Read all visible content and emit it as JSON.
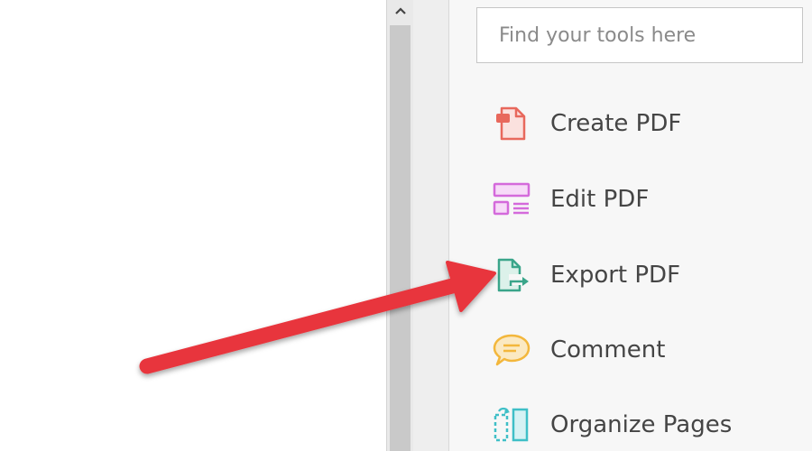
{
  "search": {
    "placeholder": "Find your tools here",
    "value": ""
  },
  "tools": [
    {
      "label": "Create PDF",
      "icon": "create-pdf-icon",
      "color": "#e8685c"
    },
    {
      "label": "Edit PDF",
      "icon": "edit-pdf-icon",
      "color": "#d46adb"
    },
    {
      "label": "Export PDF",
      "icon": "export-pdf-icon",
      "color": "#3aa58a"
    },
    {
      "label": "Comment",
      "icon": "comment-icon",
      "color": "#f3b73c"
    },
    {
      "label": "Organize Pages",
      "icon": "organize-pages-icon",
      "color": "#3fbfc7"
    }
  ],
  "annotation": {
    "arrow_color": "#e8363d",
    "points_to": "Export PDF"
  },
  "colors": {
    "scrollbar_track": "#e9e9e9",
    "scrollbar_thumb": "#c9c9c9",
    "pane_background": "#f7f7f7"
  }
}
